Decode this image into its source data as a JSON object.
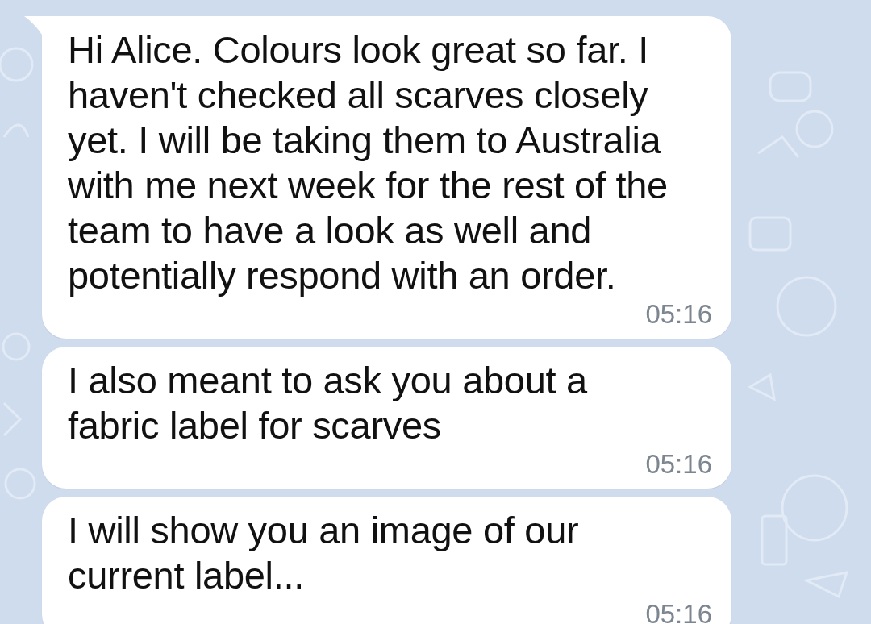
{
  "messages": [
    {
      "text": "Hi Alice. Colours look great so far. I haven't checked all scarves closely yet. I will be taking them to Australia with me next week for the rest of the team to have a look as well and potentially respond with an order.",
      "time": "05:16",
      "tail": true
    },
    {
      "text": "I also meant to ask you about a fabric label for scarves",
      "time": "05:16",
      "tail": false
    },
    {
      "text": "I will show you an image of our current label...",
      "time": "05:16",
      "tail": false
    }
  ]
}
